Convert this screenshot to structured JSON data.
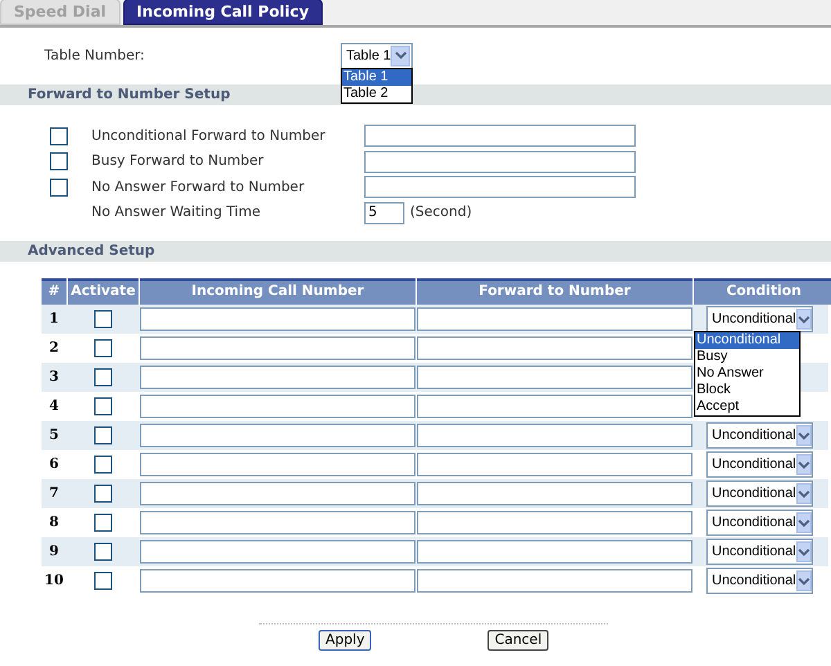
{
  "tabs": [
    {
      "label": "Speed Dial",
      "selected": false
    },
    {
      "label": "Incoming Call Policy",
      "selected": true
    }
  ],
  "table_number": {
    "label": "Table Number:",
    "value": "Table 1",
    "options": [
      {
        "label": "Table 1",
        "selected": true
      },
      {
        "label": "Table 2",
        "selected": false
      }
    ]
  },
  "forward_section": {
    "title": "Forward to Number Setup",
    "items": [
      {
        "label": "Unconditional Forward to Number",
        "checked": false
      },
      {
        "label": "Busy Forward to Number",
        "checked": false
      },
      {
        "label": "No Answer Forward to Number",
        "checked": false
      }
    ],
    "waiting": {
      "label": "No Answer Waiting Time",
      "value": "5",
      "unit": "(Second)"
    }
  },
  "advanced_section": {
    "title": "Advanced Setup",
    "columns": [
      "#",
      "Activate",
      "Incoming Call Number",
      "Forward to Number",
      "Condition"
    ],
    "rows": [
      {
        "number": "1",
        "checked": false,
        "condition": "Unconditional"
      },
      {
        "number": "2",
        "checked": false
      },
      {
        "number": "3",
        "checked": false
      },
      {
        "number": "4",
        "checked": false
      },
      {
        "number": "5",
        "checked": false,
        "condition": "Unconditional"
      },
      {
        "number": "6",
        "checked": false,
        "condition": "Unconditional"
      },
      {
        "number": "7",
        "checked": false,
        "condition": "Unconditional"
      },
      {
        "number": "8",
        "checked": false,
        "condition": "Unconditional"
      },
      {
        "number": "9",
        "checked": false,
        "condition": "Unconditional"
      },
      {
        "number": "10",
        "checked": false,
        "condition": "Unconditional"
      }
    ],
    "condition_options": [
      {
        "label": "Unconditional",
        "selected": true
      },
      {
        "label": "Busy",
        "selected": false
      },
      {
        "label": "No Answer",
        "selected": false
      },
      {
        "label": "Block",
        "selected": false
      },
      {
        "label": "Accept",
        "selected": false
      }
    ]
  },
  "buttons": [
    "Apply",
    "Cancel"
  ]
}
